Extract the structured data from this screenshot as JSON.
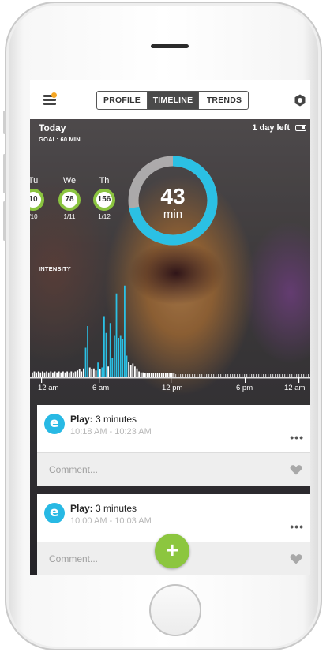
{
  "nav": {
    "tabs": [
      "PROFILE",
      "TIMELINE",
      "TRENDS"
    ],
    "active_tab": "TIMELINE"
  },
  "header": {
    "day_label": "Today",
    "goal": "GOAL: 60 MIN",
    "battery_status": "1 day left"
  },
  "week_days": [
    {
      "name": "Tu",
      "value": "10",
      "date": "/10"
    },
    {
      "name": "We",
      "value": "78",
      "date": "1/11"
    },
    {
      "name": "Th",
      "value": "156",
      "date": "1/12"
    }
  ],
  "goal_ring": {
    "value": "43",
    "unit": "min",
    "progress": 0.72,
    "color": "#2bc0e4"
  },
  "chart_data": {
    "type": "bar",
    "title": "INTENSITY",
    "xlabel": "",
    "ylabel": "",
    "x_ticks": [
      "12 am",
      "6 am",
      "12 pm",
      "6 pm",
      "12 am"
    ],
    "series": [
      {
        "color": "#2bc0e4",
        "values": [
          0,
          0,
          0,
          0,
          0,
          0,
          0,
          0,
          0,
          0,
          0,
          0,
          0,
          0,
          0,
          0,
          0,
          0,
          0,
          0,
          0,
          0,
          0,
          0,
          0,
          0,
          0,
          0,
          0,
          0,
          0,
          0,
          0,
          0,
          0,
          0,
          0,
          0,
          0,
          0,
          0,
          0,
          0,
          0,
          0,
          0,
          0,
          0,
          0,
          0,
          0,
          0,
          0,
          0,
          0,
          0,
          0,
          0,
          0,
          0,
          0,
          0,
          0,
          0,
          0,
          0,
          0,
          0,
          0,
          0,
          0,
          0,
          0,
          0,
          0,
          0,
          0,
          0,
          0,
          0,
          0,
          0,
          0,
          0,
          0,
          0,
          0,
          0,
          0,
          0,
          0,
          0,
          0,
          0,
          0,
          0,
          0,
          0,
          0,
          0,
          0,
          0,
          0,
          0,
          0,
          0,
          0,
          0,
          0,
          0,
          0,
          0,
          0,
          0,
          0,
          0,
          0,
          0,
          0,
          0,
          0,
          0,
          0,
          0,
          0,
          0,
          0,
          0,
          0,
          0,
          0,
          0,
          0,
          0,
          0,
          0,
          0,
          0
        ]
      },
      {
        "color": "#ffffff",
        "values": []
      }
    ],
    "bars": [
      {
        "h": 0.05,
        "c": "#ffffff"
      },
      {
        "h": 0.06,
        "c": "#ffffff"
      },
      {
        "h": 0.05,
        "c": "#ffffff"
      },
      {
        "h": 0.06,
        "c": "#ffffff"
      },
      {
        "h": 0.05,
        "c": "#ffffff"
      },
      {
        "h": 0.06,
        "c": "#ffffff"
      },
      {
        "h": 0.05,
        "c": "#ffffff"
      },
      {
        "h": 0.06,
        "c": "#ffffff"
      },
      {
        "h": 0.05,
        "c": "#ffffff"
      },
      {
        "h": 0.06,
        "c": "#ffffff"
      },
      {
        "h": 0.05,
        "c": "#ffffff"
      },
      {
        "h": 0.06,
        "c": "#ffffff"
      },
      {
        "h": 0.05,
        "c": "#ffffff"
      },
      {
        "h": 0.06,
        "c": "#ffffff"
      },
      {
        "h": 0.05,
        "c": "#ffffff"
      },
      {
        "h": 0.06,
        "c": "#ffffff"
      },
      {
        "h": 0.05,
        "c": "#ffffff"
      },
      {
        "h": 0.06,
        "c": "#ffffff"
      },
      {
        "h": 0.05,
        "c": "#ffffff"
      },
      {
        "h": 0.06,
        "c": "#ffffff"
      },
      {
        "h": 0.05,
        "c": "#ffffff"
      },
      {
        "h": 0.06,
        "c": "#ffffff"
      },
      {
        "h": 0.07,
        "c": "#ffffff"
      },
      {
        "h": 0.08,
        "c": "#ffffff"
      },
      {
        "h": 0.06,
        "c": "#ffffff"
      },
      {
        "h": 0.09,
        "c": "#ffffff"
      },
      {
        "h": 0.3,
        "c": "#2bc0e4"
      },
      {
        "h": 0.52,
        "c": "#2bc0e4"
      },
      {
        "h": 0.1,
        "c": "#ffffff"
      },
      {
        "h": 0.08,
        "c": "#ffffff"
      },
      {
        "h": 0.09,
        "c": "#ffffff"
      },
      {
        "h": 0.07,
        "c": "#ffffff"
      },
      {
        "h": 0.15,
        "c": "#2bc0e4"
      },
      {
        "h": 0.08,
        "c": "#ffffff"
      },
      {
        "h": 0.1,
        "c": "#2bc0e4"
      },
      {
        "h": 0.62,
        "c": "#2bc0e4"
      },
      {
        "h": 0.45,
        "c": "#2bc0e4"
      },
      {
        "h": 0.11,
        "c": "#ffffff"
      },
      {
        "h": 0.55,
        "c": "#2bc0e4"
      },
      {
        "h": 0.2,
        "c": "#2bc0e4"
      },
      {
        "h": 0.42,
        "c": "#2bc0e4"
      },
      {
        "h": 0.85,
        "c": "#2bc0e4"
      },
      {
        "h": 0.4,
        "c": "#2bc0e4"
      },
      {
        "h": 0.42,
        "c": "#2bc0e4"
      },
      {
        "h": 0.39,
        "c": "#2bc0e4"
      },
      {
        "h": 0.93,
        "c": "#2bc0e4"
      },
      {
        "h": 0.22,
        "c": "#2bc0e4"
      },
      {
        "h": 0.16,
        "c": "#ffffff"
      },
      {
        "h": 0.12,
        "c": "#ffffff"
      },
      {
        "h": 0.14,
        "c": "#ffffff"
      },
      {
        "h": 0.11,
        "c": "#ffffff"
      },
      {
        "h": 0.09,
        "c": "#ffffff"
      },
      {
        "h": 0.06,
        "c": "#ffffff"
      },
      {
        "h": 0.05,
        "c": "#ffffff"
      },
      {
        "h": 0.05,
        "c": "#ffffff"
      },
      {
        "h": 0.04,
        "c": "#ffffff"
      },
      {
        "h": 0.04,
        "c": "#ffffff"
      },
      {
        "h": 0.04,
        "c": "#ffffff"
      },
      {
        "h": 0.04,
        "c": "#ffffff"
      },
      {
        "h": 0.04,
        "c": "#ffffff"
      },
      {
        "h": 0.04,
        "c": "#ffffff"
      },
      {
        "h": 0.04,
        "c": "#ffffff"
      },
      {
        "h": 0.04,
        "c": "#ffffff"
      },
      {
        "h": 0.04,
        "c": "#ffffff"
      },
      {
        "h": 0.04,
        "c": "#ffffff"
      },
      {
        "h": 0.04,
        "c": "#ffffff"
      },
      {
        "h": 0.04,
        "c": "#ffffff"
      },
      {
        "h": 0.04,
        "c": "#ffffff"
      },
      {
        "h": 0.04,
        "c": "#ffffff"
      },
      {
        "h": 0.04,
        "c": "#ffffff"
      }
    ]
  },
  "activities": [
    {
      "type": "Play:",
      "duration": " 3 minutes",
      "time": "10:18 AM - 10:23 AM",
      "comment_placeholder": "Comment..."
    },
    {
      "type": "Play:",
      "duration": " 3 minutes",
      "time": "10:00 AM - 10:03 AM",
      "comment_placeholder": "Comment..."
    }
  ],
  "icons": {
    "menu": "hamburger-menu-icon",
    "settings": "hexagon-settings-icon",
    "battery": "battery-icon",
    "activity": "activity-e-icon",
    "more": "more-dots-icon",
    "heart": "heart-icon",
    "add": "plus-icon"
  },
  "colors": {
    "accent_blue": "#2bc0e4",
    "accent_green": "#8cc63f",
    "notification": "#f5a623"
  },
  "labels": {
    "more": "•••",
    "add": "+",
    "avatar_letter": "e"
  }
}
